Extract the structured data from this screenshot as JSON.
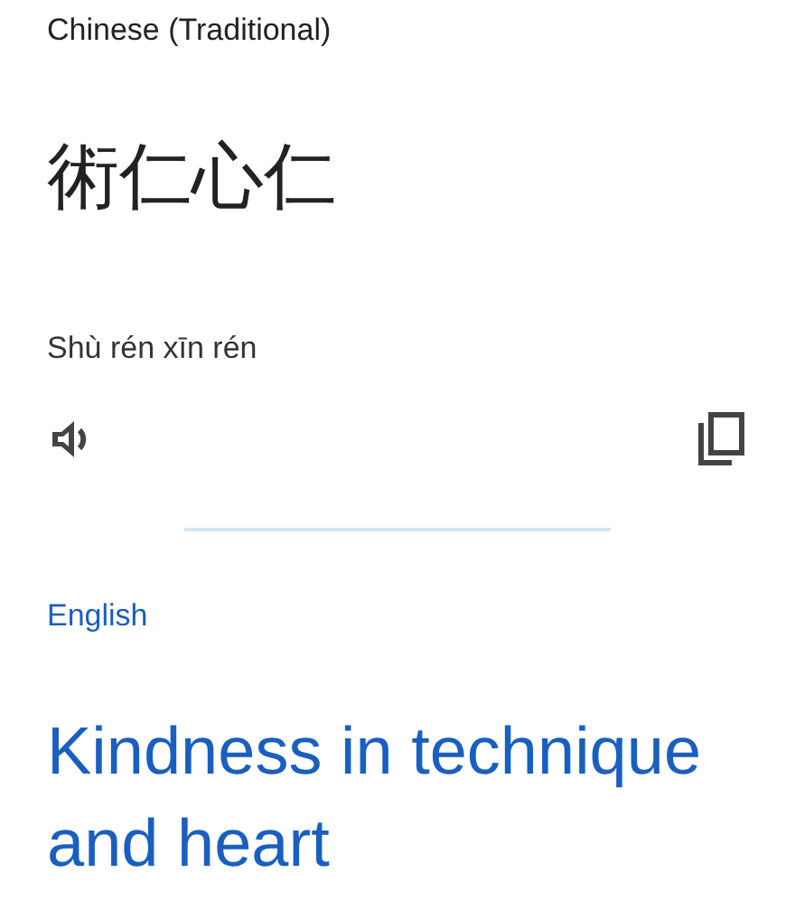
{
  "source": {
    "language": "Chinese (Traditional)",
    "text": "術仁心仁",
    "transliteration": "Shù rén xīn rén"
  },
  "target": {
    "language": "English",
    "text": "Kindness in technique and heart"
  }
}
